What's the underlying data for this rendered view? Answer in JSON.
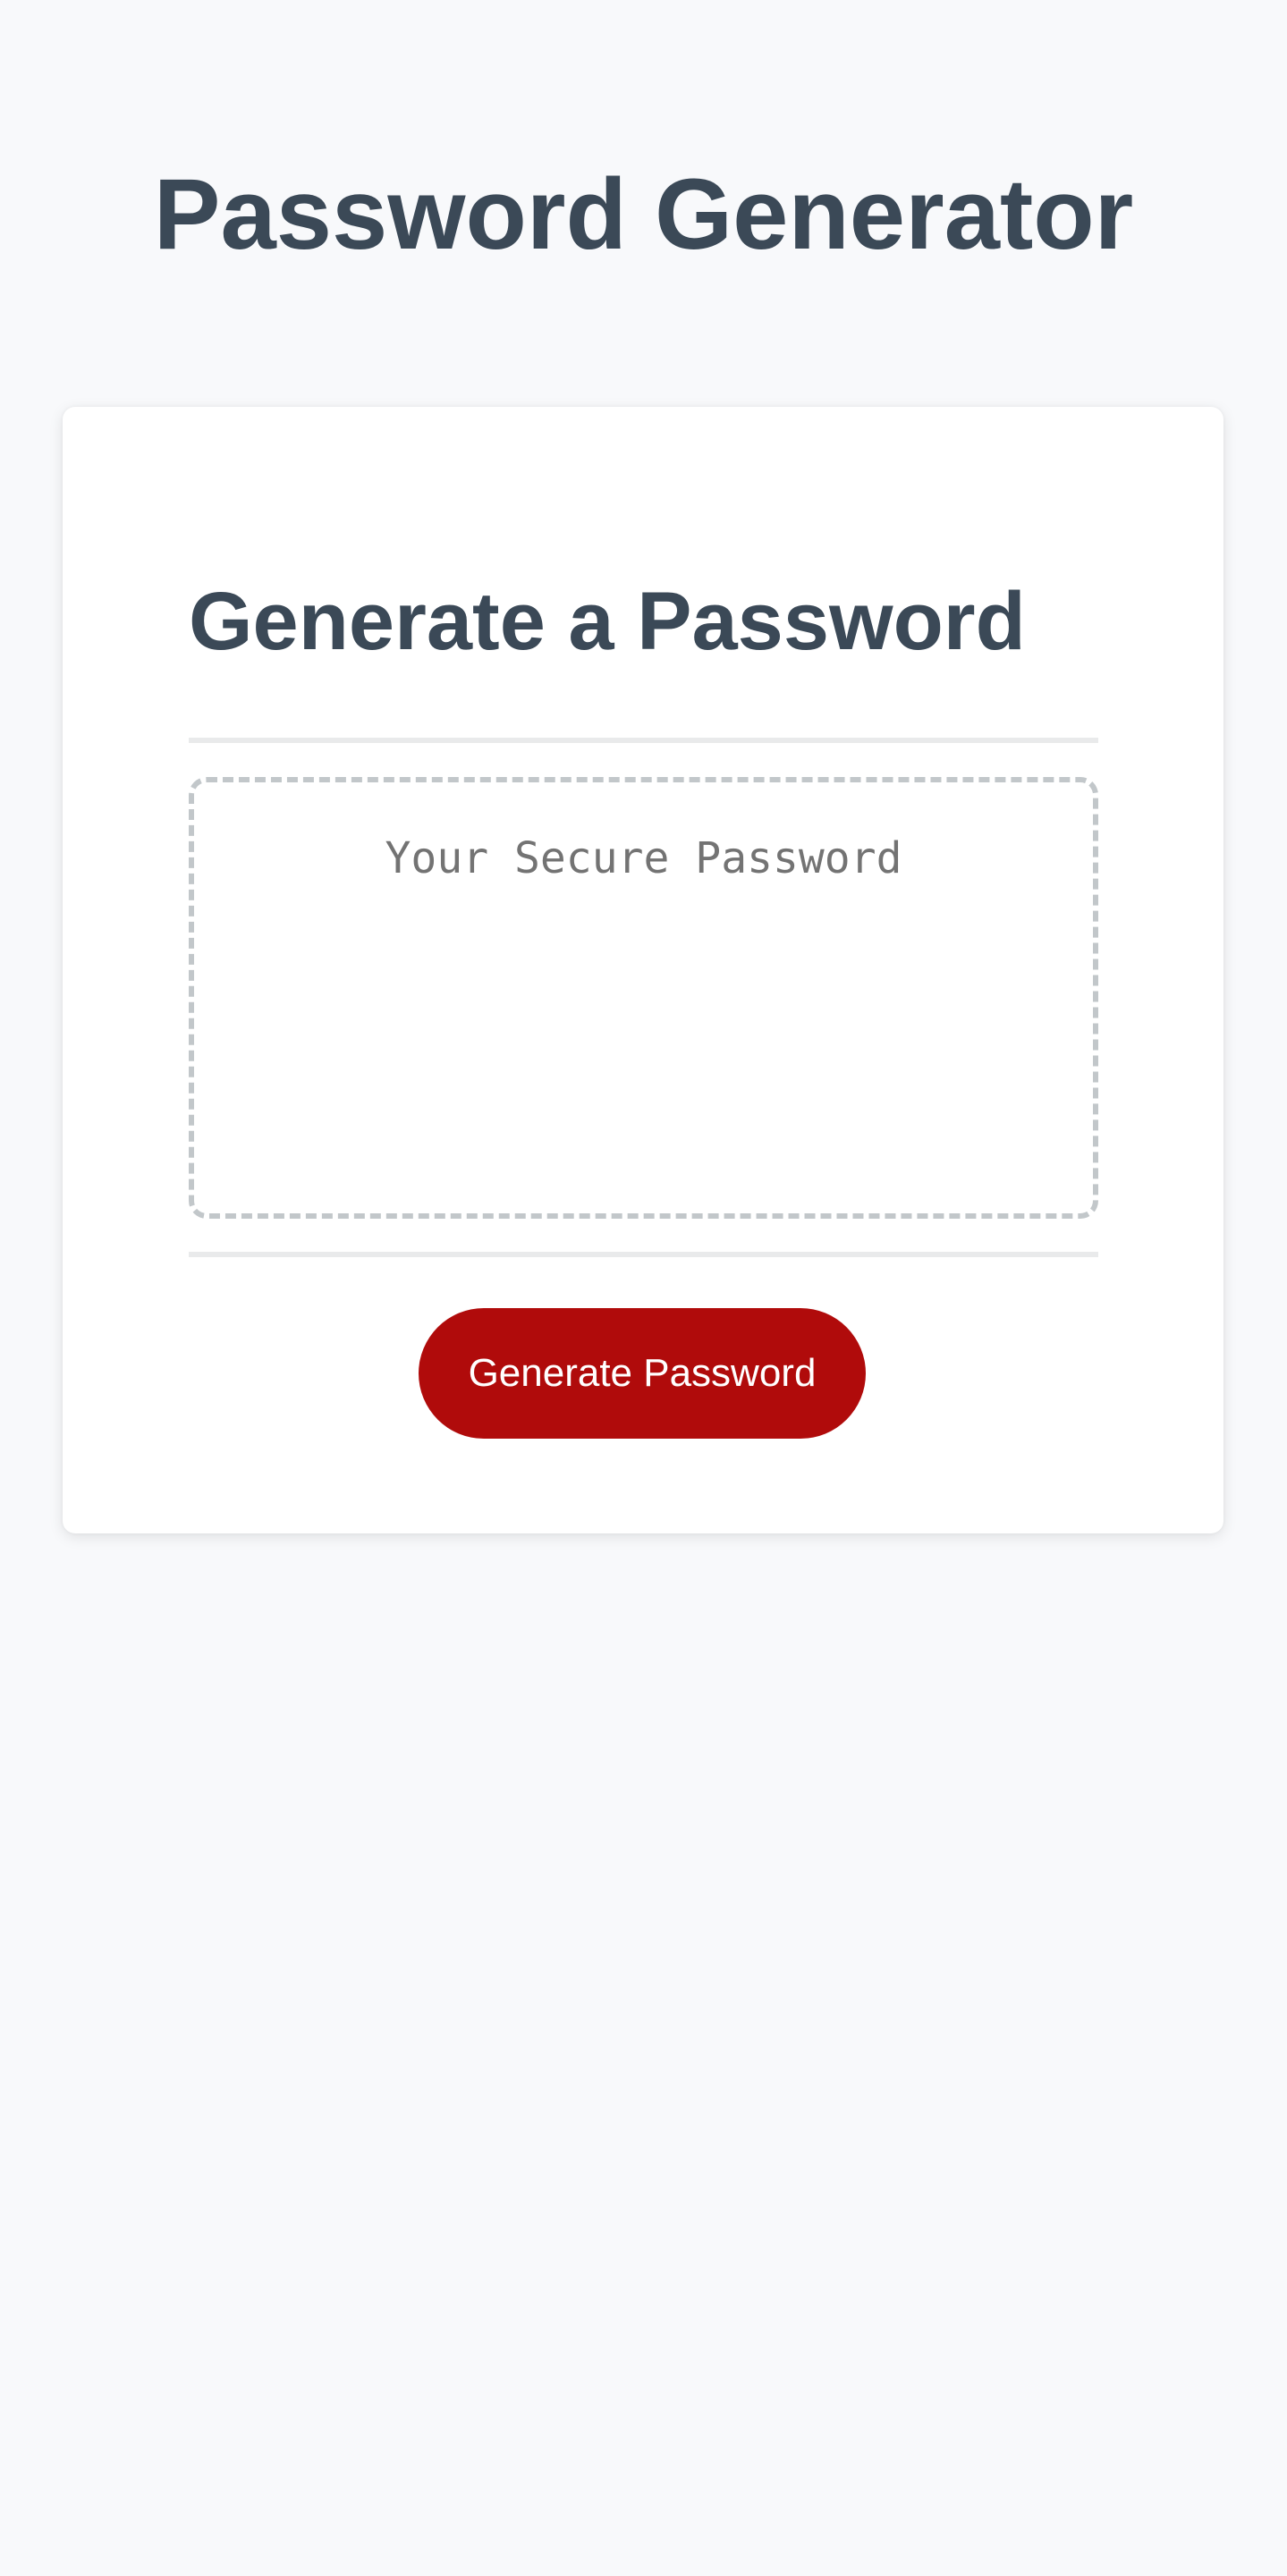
{
  "header": {
    "title": "Password Generator"
  },
  "card": {
    "title": "Generate a Password",
    "password": {
      "value": "",
      "placeholder": "Your Secure Password"
    },
    "generate_button_label": "Generate Password"
  },
  "colors": {
    "background": "#f8f9fb",
    "heading_text": "#3b4957",
    "button_red": "#b00b0b",
    "box_border": "#c2c7ca",
    "divider": "#e9eaeb"
  }
}
